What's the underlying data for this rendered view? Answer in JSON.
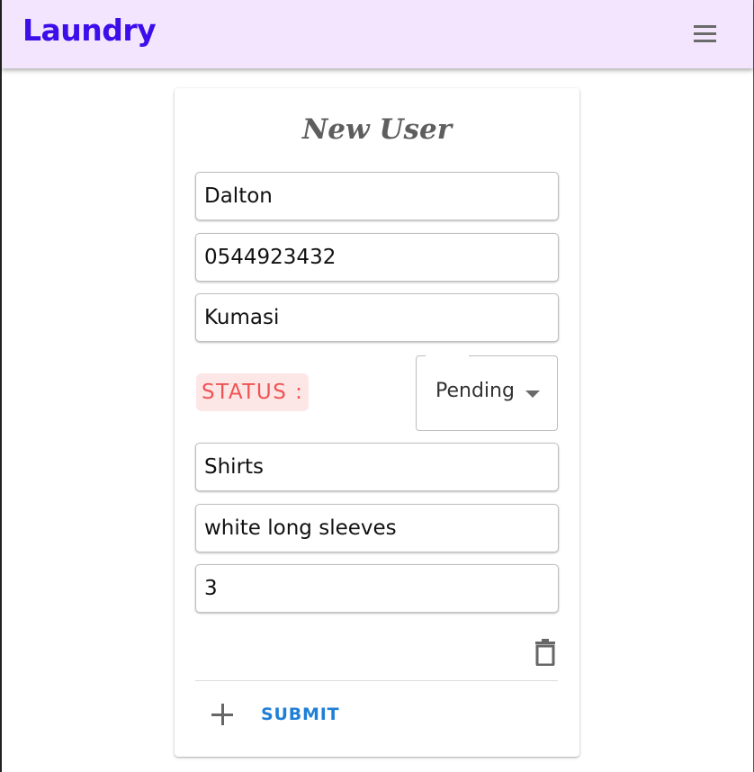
{
  "app": {
    "title": "Laundry"
  },
  "header": {
    "menu_icon": "hamburger-menu-icon"
  },
  "form": {
    "title": "New User",
    "name_value": "Dalton",
    "phone_value": "0544923432",
    "location_value": "Kumasi",
    "status_label": "STATUS :",
    "status_selected": "Pending",
    "item_value": "Shirts",
    "description_value": "white long sleeves",
    "quantity_value": "3",
    "delete_icon": "trash-icon",
    "add_icon": "plus-icon",
    "submit_label": "SUBMIT"
  },
  "colors": {
    "appbar_bg": "#f3e5fd",
    "brand": "#3d0dea",
    "status_text": "#ef5454",
    "status_bg": "#fde6e6",
    "submit": "#1f7fd6"
  }
}
